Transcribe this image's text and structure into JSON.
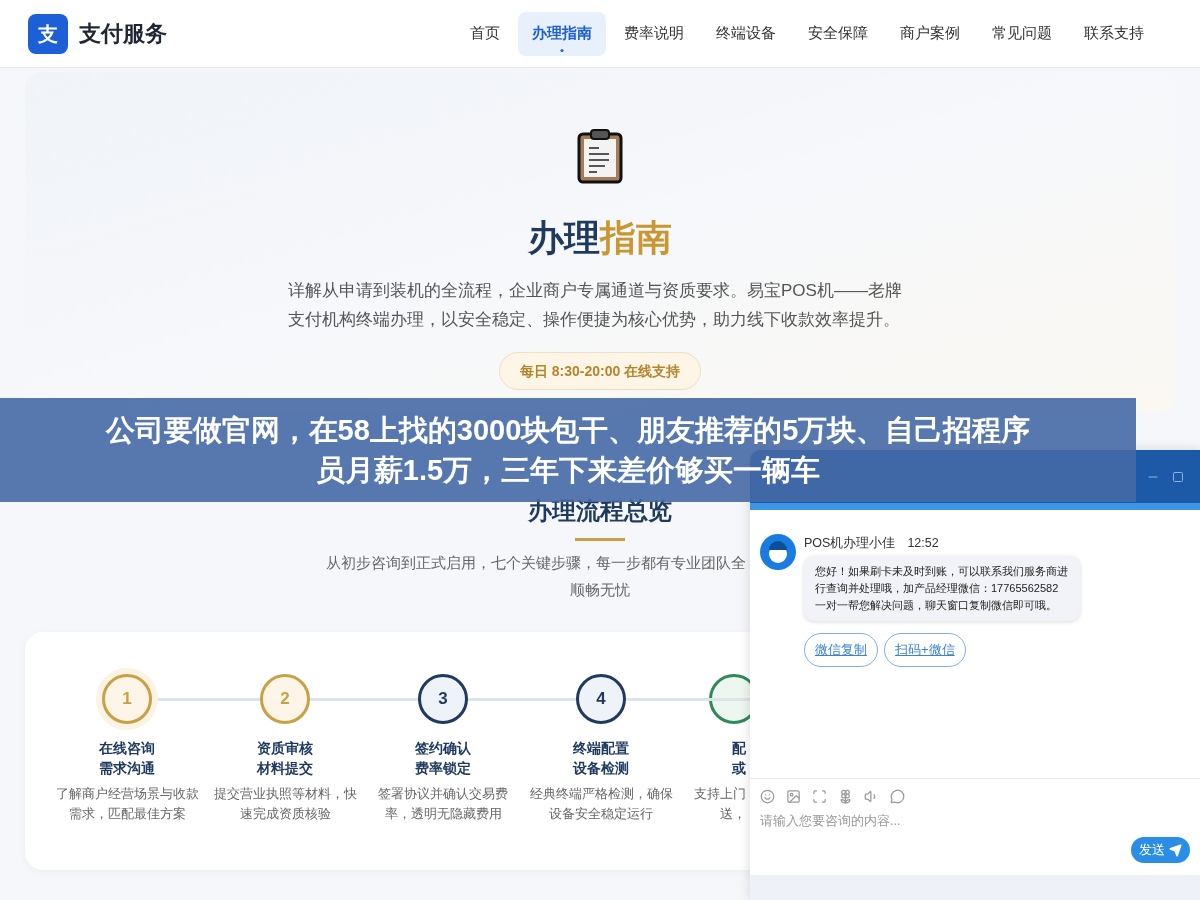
{
  "header": {
    "logo_mark": "支",
    "brand": "支付服务",
    "nav": [
      {
        "label": "首页",
        "selected": false
      },
      {
        "label": "办理指南",
        "selected": true
      },
      {
        "label": "费率说明",
        "selected": false
      },
      {
        "label": "终端设备",
        "selected": false
      },
      {
        "label": "安全保障",
        "selected": false
      },
      {
        "label": "商户案例",
        "selected": false
      },
      {
        "label": "常见问题",
        "selected": false
      },
      {
        "label": "联系支持",
        "selected": false
      }
    ]
  },
  "hero": {
    "title_main": "办理",
    "title_accent": "指南",
    "description": "详解从申请到装机的全流程，企业商户专属通道与资质要求。易宝POS机——老牌支付机构终端办理，以安全稳定、操作便捷为核心优势，助力线下收款效率提升。",
    "hours_badge": "每日 8:30-20:00 在线支持"
  },
  "overlay_banner": {
    "lines": [
      "公司要做官网，在58上找的3000块包干、朋友推荐的5万块、自己招程序",
      "员月薪1.5万，三年下来差价够买一辆车"
    ]
  },
  "process": {
    "title": "办理流程总览",
    "subtitle_lines": [
      "从初步咨询到正式启用，七个关键步骤，每一步都有专业团队全",
      "顺畅无忧"
    ],
    "steps": [
      {
        "number": "1",
        "title_lines": [
          "在线咨询",
          "需求沟通"
        ],
        "desc_lines": [
          "了解商户经营场景与收款",
          "需求，匹配最佳方案"
        ],
        "color": "#c9a043"
      },
      {
        "number": "2",
        "title_lines": [
          "资质审核",
          "材料提交"
        ],
        "desc_lines": [
          "提交营业执照等材料，快",
          "速完成资质核验"
        ],
        "color": "#c9a043"
      },
      {
        "number": "3",
        "title_lines": [
          "签约确认",
          "费率锁定"
        ],
        "desc_lines": [
          "签署协议并确认交易费",
          "率，透明无隐藏费用"
        ],
        "color": "#1e3a5f"
      },
      {
        "number": "4",
        "title_lines": [
          "终端配置",
          "设备检测"
        ],
        "desc_lines": [
          "经典终端严格检测，确保",
          "设备安全稳定运行"
        ],
        "color": "#1e3a5f"
      },
      {
        "title_lines": [
          "配",
          "或"
        ],
        "desc_lines": [
          "支持上门",
          "送，"
        ],
        "color": "#2e8b57"
      }
    ]
  },
  "chat": {
    "agent_name": "POS机办理小佳",
    "time": "12:52",
    "message": "您好！如果刷卡未及时到账，可以联系我们服务商进行查询并处理哦，加产品经理微信：17765562582 一对一帮您解决问题，聊天窗口复制微信即可哦。",
    "quick_replies": [
      "微信复制",
      "扫码+微信"
    ],
    "input_placeholder": "请输入您要咨询的内容...",
    "send_label": "发送"
  }
}
